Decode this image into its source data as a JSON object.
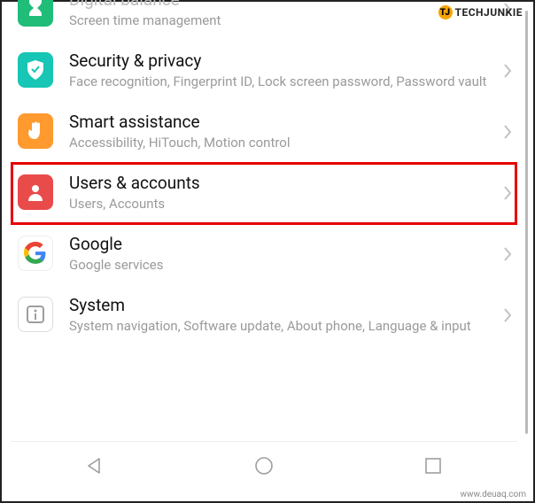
{
  "watermarks": {
    "top_brand": "TECHJUNKIE",
    "top_icon_text": "TJ",
    "bottom": "www.deuaq.com"
  },
  "settings": {
    "items": [
      {
        "icon": "hourglass-icon",
        "color": "ic-green",
        "title": "Digital balance",
        "subtitle": "Screen time management"
      },
      {
        "icon": "shield-icon",
        "color": "ic-teal",
        "title": "Security & privacy",
        "subtitle": "Face recognition, Fingerprint ID, Lock screen password, Password vault"
      },
      {
        "icon": "hand-icon",
        "color": "ic-orange",
        "title": "Smart assistance",
        "subtitle": "Accessibility, HiTouch, Motion control"
      },
      {
        "icon": "person-icon",
        "color": "ic-red",
        "title": "Users & accounts",
        "subtitle": "Users, Accounts"
      },
      {
        "icon": "google-icon",
        "color": "ic-google",
        "title": "Google",
        "subtitle": "Google services"
      },
      {
        "icon": "system-icon",
        "color": "ic-gray",
        "title": "System",
        "subtitle": "System navigation, Software update, About phone, Language & input"
      }
    ],
    "highlighted_index": 3
  },
  "navbar": {
    "back": "back-triangle-icon",
    "home": "home-circle-icon",
    "recent": "recent-square-icon"
  }
}
